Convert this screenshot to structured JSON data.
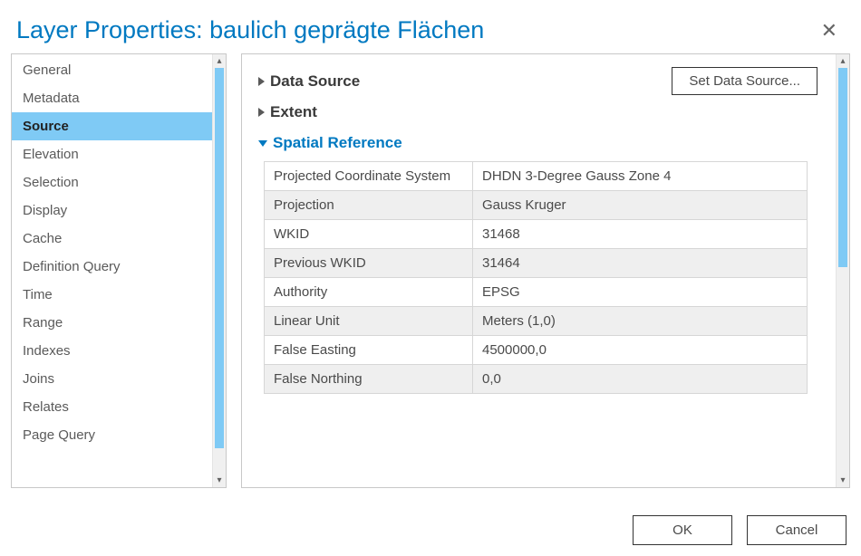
{
  "title": "Layer Properties: baulich geprägte Flächen",
  "sidebar": {
    "items": [
      {
        "label": "General"
      },
      {
        "label": "Metadata"
      },
      {
        "label": "Source",
        "selected": true
      },
      {
        "label": "Elevation"
      },
      {
        "label": "Selection"
      },
      {
        "label": "Display"
      },
      {
        "label": "Cache"
      },
      {
        "label": "Definition Query"
      },
      {
        "label": "Time"
      },
      {
        "label": "Range"
      },
      {
        "label": "Indexes"
      },
      {
        "label": "Joins"
      },
      {
        "label": "Relates"
      },
      {
        "label": "Page Query"
      }
    ]
  },
  "content": {
    "set_data_source_label": "Set Data Source...",
    "sections": {
      "data_source": {
        "title": "Data Source",
        "expanded": false
      },
      "extent": {
        "title": "Extent",
        "expanded": false
      },
      "spatial_reference": {
        "title": "Spatial Reference",
        "expanded": true,
        "rows": [
          {
            "k": "Projected Coordinate System",
            "v": "DHDN 3-Degree Gauss Zone 4"
          },
          {
            "k": "Projection",
            "v": "Gauss Kruger"
          },
          {
            "k": "WKID",
            "v": "31468"
          },
          {
            "k": "Previous WKID",
            "v": "31464"
          },
          {
            "k": "Authority",
            "v": "EPSG"
          },
          {
            "k": "Linear Unit",
            "v": "Meters (1,0)"
          },
          {
            "k": "False Easting",
            "v": "4500000,0"
          },
          {
            "k": "False Northing",
            "v": "0,0"
          }
        ]
      }
    }
  },
  "footer": {
    "ok_label": "OK",
    "cancel_label": "Cancel"
  }
}
